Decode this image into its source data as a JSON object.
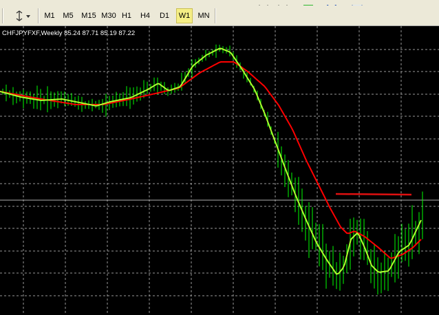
{
  "toolbar": {
    "timeframes": [
      {
        "label": "M1",
        "active": false
      },
      {
        "label": "M5",
        "active": false
      },
      {
        "label": "M15",
        "active": false
      },
      {
        "label": "M30",
        "active": false
      },
      {
        "label": "H1",
        "active": false
      },
      {
        "label": "H4",
        "active": false
      },
      {
        "label": "D1",
        "active": false
      },
      {
        "label": "W1",
        "active": true
      },
      {
        "label": "MN",
        "active": false
      }
    ],
    "icons": [
      "crosshair-icon",
      "line-tools-icon",
      "new-order-icon",
      "navigator-icon",
      "picture-icon"
    ]
  },
  "chart": {
    "header_text": "CHFJPYFXF,Weekly  85.24 87.71 85.19 87.22",
    "colors": {
      "background": "#000000",
      "grid": "#9A9A9A",
      "bars": "#00FF00",
      "fast_ma": "#ADFF2F",
      "slow_ma": "#FF0000"
    }
  },
  "chart_data": {
    "type": "line",
    "symbol": "CHFJPYFXF",
    "timeframe": "Weekly",
    "last_ohlc": {
      "open": 85.24,
      "high": 87.71,
      "low": 85.19,
      "close": 87.22
    },
    "grid": true,
    "series": [
      {
        "kind": "bars",
        "color": "#00FF00"
      },
      {
        "kind": "fast-ma",
        "color": "#ADFF2F"
      },
      {
        "kind": "slow-ma",
        "color": "#FF0000"
      }
    ],
    "annotations": [
      {
        "kind": "horizontal-segment",
        "color": "#FF0000"
      },
      {
        "kind": "horizontal-line",
        "color": "#B0B0B0"
      }
    ]
  }
}
